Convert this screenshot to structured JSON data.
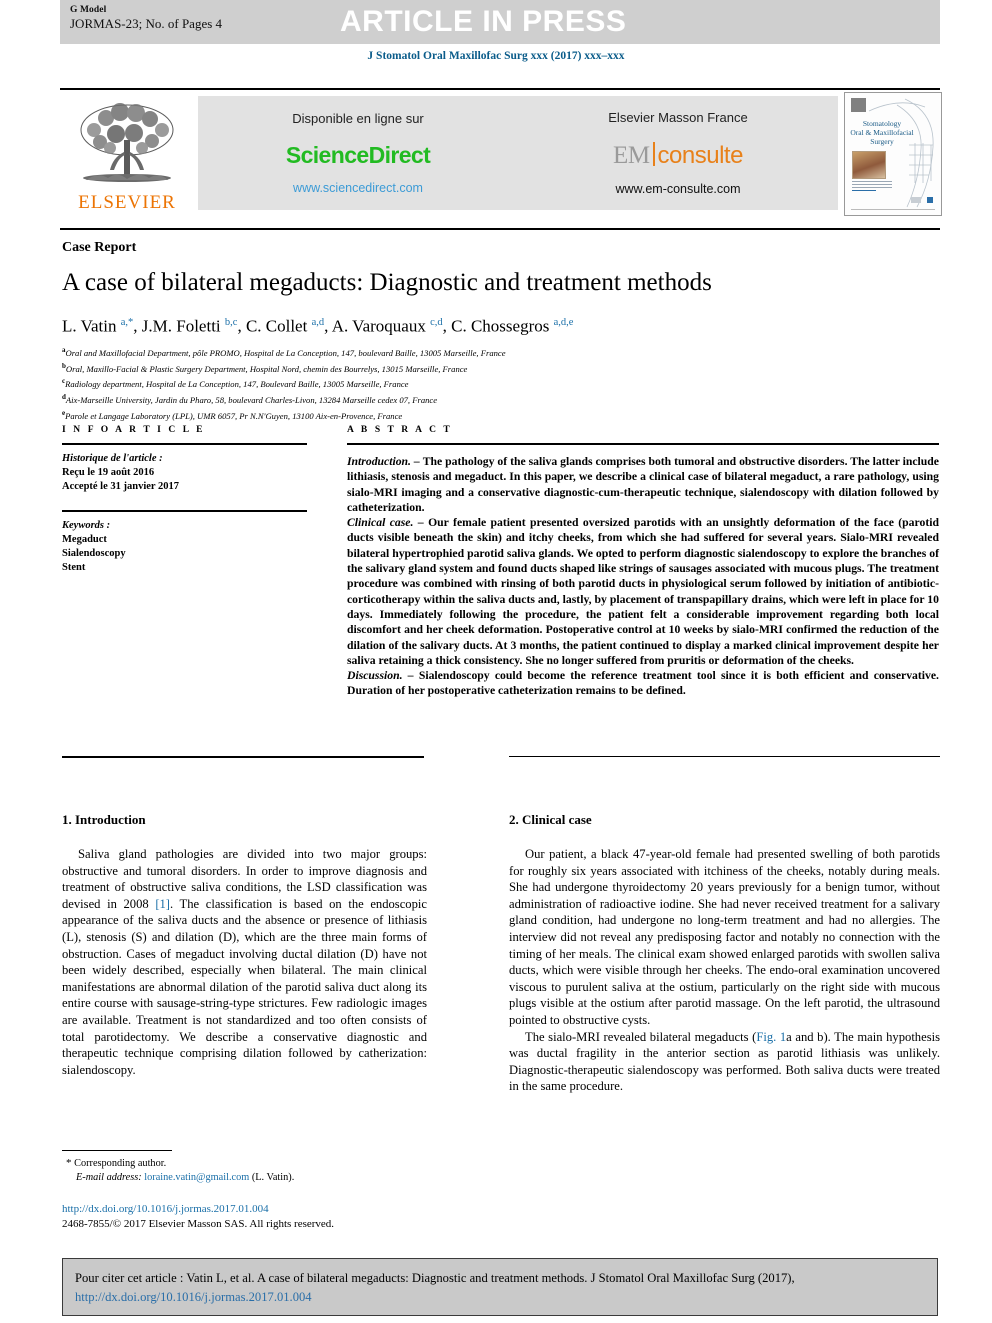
{
  "banner": {
    "g_model": "G Model",
    "article_id": "JORMAS-23; No. of Pages 4",
    "status": "ARTICLE IN PRESS"
  },
  "journal_ref": "J Stomatol Oral Maxillofac Surg xxx (2017) xxx–xxx",
  "masthead": {
    "publisher_logo_text": "ELSEVIER",
    "sciencedirect": {
      "available_label": "Disponible en ligne sur",
      "logo": "ScienceDirect",
      "url": "www.sciencedirect.com"
    },
    "emconsulte": {
      "title": "Elsevier Masson France",
      "logo_left": "EM",
      "logo_right": "consulte",
      "url": "www.em-consulte.com"
    },
    "cover": {
      "title_line1": "Stomatology",
      "title_line2": "Oral & Maxillofacial",
      "title_line3": "Surgery"
    }
  },
  "article": {
    "type": "Case Report",
    "title": "A case of bilateral megaducts: Diagnostic and treatment methods",
    "authors_html": "L. Vatin <sup>a,*</sup>, J.M. Foletti <sup>b,c</sup>, C. Collet <sup>a,d</sup>, A. Varoquaux <sup>c,d</sup>, C. Chossegros <sup>a,d,e</sup>",
    "affiliations": [
      {
        "mark": "a",
        "text": "Oral and Maxillofacial Department, pôle PROMO, Hospital de La Conception, 147, boulevard Baille, 13005 Marseille, France"
      },
      {
        "mark": "b",
        "text": "Oral, Maxillo-Facial & Plastic Surgery Department, Hospital Nord, chemin des Bourrelys, 13015 Marseille, France"
      },
      {
        "mark": "c",
        "text": "Radiology department, Hospital de La Conception, 147, Boulevard Baille, 13005 Marseille, France"
      },
      {
        "mark": "d",
        "text": "Aix-Marseille University, Jardin du Pharo, 58, boulevard Charles-Livon, 13284 Marseille cedex 07, France"
      },
      {
        "mark": "e",
        "text": "Parole et Langage Laboratory (LPL), UMR 6057, Pr N.N'Guyen, 13100 Aix-en-Provence, France"
      }
    ]
  },
  "info": {
    "label": "I N F O   A R T I C L E",
    "history_label": "Historique de l'article :",
    "received": "Reçu le 19 août 2016",
    "accepted": "Accepté le 31 janvier 2017",
    "keywords_label": "Keywords :",
    "keywords": [
      "Megaduct",
      "Sialendoscopy",
      "Stent"
    ]
  },
  "abstract": {
    "label": "A B S T R A C T",
    "paragraphs": [
      {
        "lead": "Introduction. – ",
        "text": "The pathology of the saliva glands comprises both tumoral and obstructive disorders. The latter include lithiasis, stenosis and megaduct. In this paper, we describe a clinical case of bilateral megaduct, a rare pathology, using sialo-MRI imaging and a conservative diagnostic-cum-therapeutic technique, sialendoscopy with dilation followed by catheterization."
      },
      {
        "lead": "Clinical case. – ",
        "text": "Our female patient presented oversized parotids with an unsightly deformation of the face (parotid ducts visible beneath the skin) and itchy cheeks, from which she had suffered for several years. Sialo-MRI revealed bilateral hypertrophied parotid saliva glands. We opted to perform diagnostic sialendoscopy to explore the branches of the salivary gland system and found ducts shaped like strings of sausages associated with mucous plugs. The treatment procedure was combined with rinsing of both parotid ducts in physiological serum followed by initiation of antibiotic-corticotherapy within the saliva ducts and, lastly, by placement of transpapillary drains, which were left in place for 10 days. Immediately following the procedure, the patient felt a considerable improvement regarding both local discomfort and her cheek deformation. Postoperative control at 10 weeks by sialo-MRI confirmed the reduction of the dilation of the salivary ducts. At 3 months, the patient continued to display a marked clinical improvement despite her saliva retaining a thick consistency. She no longer suffered from pruritis or deformation of the cheeks."
      },
      {
        "lead": "Discussion. – ",
        "text": "Sialendoscopy could become the reference treatment tool since it is both efficient and conservative. Duration of her postoperative catheterization remains to be defined."
      }
    ]
  },
  "sections": {
    "introduction": {
      "heading": "1. Introduction",
      "paragraph_part1": "Saliva gland pathologies are divided into two major groups: obstructive and tumoral disorders. In order to improve diagnosis and treatment of obstructive saliva conditions, the LSD classification was devised in 2008 ",
      "citation": "[1]",
      "paragraph_part2": ". The classification is based on the endoscopic appearance of the saliva ducts and the absence or presence of lithiasis (L), stenosis (S) and dilation (D), which are the three main forms of obstruction. Cases of megaduct involving ductal dilation (D) have not been widely described, especially when bilateral. The main clinical manifestations are abnormal dilation of the parotid saliva duct along its entire course with sausage-string-type strictures. Few radiologic images are available. Treatment is not standardized and too often consists of total parotidectomy. We describe a conservative diagnostic and therapeutic technique comprising dilation followed by catherization: sialendoscopy."
    },
    "clinical_case": {
      "heading": "2. Clinical case",
      "paragraph1": "Our patient, a black 47-year-old female had presented swelling of both parotids for roughly six years associated with itchiness of the cheeks, notably during meals. She had undergone thyroidectomy 20 years previously for a benign tumor, without administration of radioactive iodine. She had never received treatment for a salivary gland condition, had undergone no long-term treatment and had no allergies. The interview did not reveal any predisposing factor and notably no connection with the timing of her meals. The clinical exam showed enlarged parotids with swollen saliva ducts, which were visible through her cheeks. The endo-oral examination uncovered viscous to purulent saliva at the ostium, particularly on the right side with mucous plugs visible at the ostium after parotid massage. On the left parotid, the ultrasound pointed to obstructive cysts.",
      "paragraph2_part1": "The sialo-MRI revealed bilateral megaducts (",
      "figure_ref": "Fig. 1",
      "paragraph2_part2": "a and b). The main hypothesis was ductal fragility in the anterior section as parotid lithiasis was unlikely. Diagnostic-therapeutic sialendoscopy was performed. Both saliva ducts were treated in the same procedure."
    }
  },
  "footnote": {
    "star": "*",
    "corresponding": "Corresponding author.",
    "email_label": "E-mail address:",
    "email": "loraine.vatin@gmail.com",
    "email_owner": "(L. Vatin)."
  },
  "doi_block": {
    "doi_url": "http://dx.doi.org/10.1016/j.jormas.2017.01.004",
    "copyright": "2468-7855/© 2017 Elsevier Masson SAS. All rights reserved."
  },
  "citation_box": {
    "prefix": "Pour citer cet article : Vatin L, et al. A case of bilateral megaducts: Diagnostic and treatment methods. J Stomatol Oral Maxillofac Surg (2017), ",
    "doi": "http://dx.doi.org/10.1016/j.jormas.2017.01.004"
  },
  "colors": {
    "link_blue": "#1a6fa8",
    "elsevier_orange": "#ec7404",
    "sciencedirect_green": "#22bb22",
    "banner_grey": "#cfcfcf"
  }
}
